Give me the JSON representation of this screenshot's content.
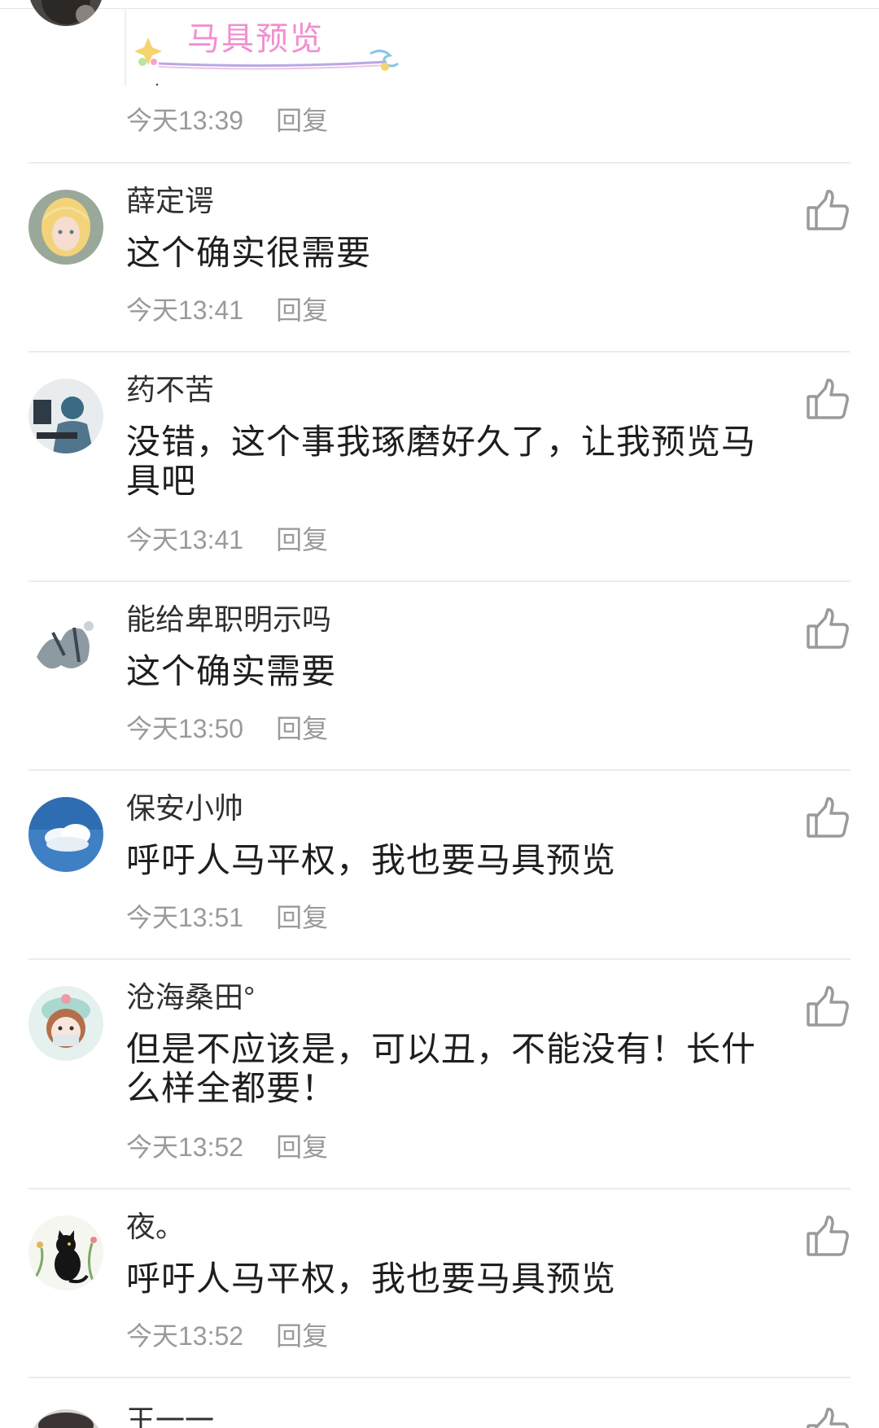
{
  "first_comment": {
    "sticker_text": "马具预览",
    "time": "今天13:39",
    "reply": "回复"
  },
  "comments": [
    {
      "username": "薛定谔",
      "content": "这个确实很需要",
      "time": "今天13:41",
      "reply": "回复"
    },
    {
      "username": "药不苦",
      "content": "没错，这个事我琢磨好久了，让我预览马具吧",
      "time": "今天13:41",
      "reply": "回复"
    },
    {
      "username": "能给卑职明示吗",
      "content": "这个确实需要",
      "time": "今天13:50",
      "reply": "回复"
    },
    {
      "username": "保安小帅",
      "content": "呼吁人马平权，我也要马具预览",
      "time": "今天13:51",
      "reply": "回复"
    },
    {
      "username": "沧海桑田°",
      "content": "但是不应该是，可以丑，不能没有！长什么样全都要！",
      "time": "今天13:52",
      "reply": "回复"
    },
    {
      "username": "夜。",
      "content": "呼吁人马平权，我也要马具预览",
      "time": "今天13:52",
      "reply": "回复"
    },
    {
      "username": "王一一",
      "content": "",
      "time": "",
      "reply": ""
    }
  ],
  "colors": {
    "meta_text": "#9a9a9a",
    "divider": "#ececec",
    "sticker_text": "#f28fd0",
    "like_icon": "#9a9a9a"
  },
  "icons": {
    "like": "thumbs-up-icon"
  }
}
